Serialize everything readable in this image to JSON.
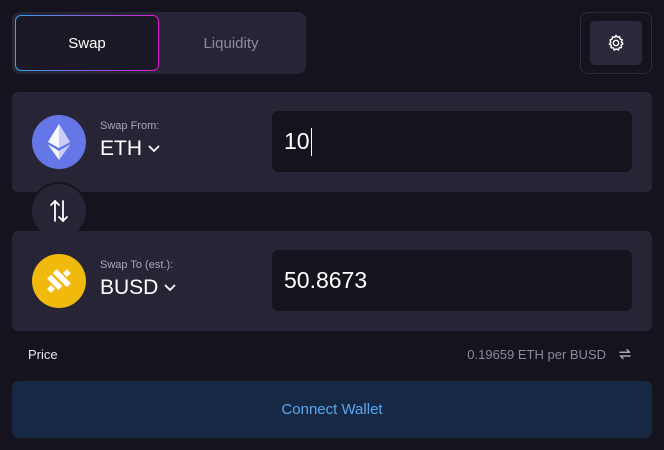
{
  "tabs": [
    {
      "label": "Swap",
      "active": true
    },
    {
      "label": "Liquidity",
      "active": false
    }
  ],
  "settings": {
    "icon": "gear-icon"
  },
  "swap_from": {
    "label": "Swap From:",
    "token": "ETH",
    "icon": "ethereum-logo-icon",
    "amount": "10"
  },
  "swap_to": {
    "label": "Swap To (est.):",
    "token": "BUSD",
    "icon": "busd-logo-icon",
    "amount": "50.8673"
  },
  "switch": {
    "icon": "swap-arrows-icon"
  },
  "price": {
    "label": "Price",
    "value": "0.19659 ETH per BUSD",
    "icon": "refresh-icon"
  },
  "connect_wallet": {
    "label": "Connect Wallet"
  },
  "colors": {
    "background": "#15131d",
    "panel": "#272535",
    "accent_blue": "#2ca7f5",
    "accent_pink": "#e21ad8",
    "eth": "#6577e6",
    "busd": "#f1b90c",
    "connect_bg": "#172844",
    "connect_text": "#5ba8f2"
  }
}
